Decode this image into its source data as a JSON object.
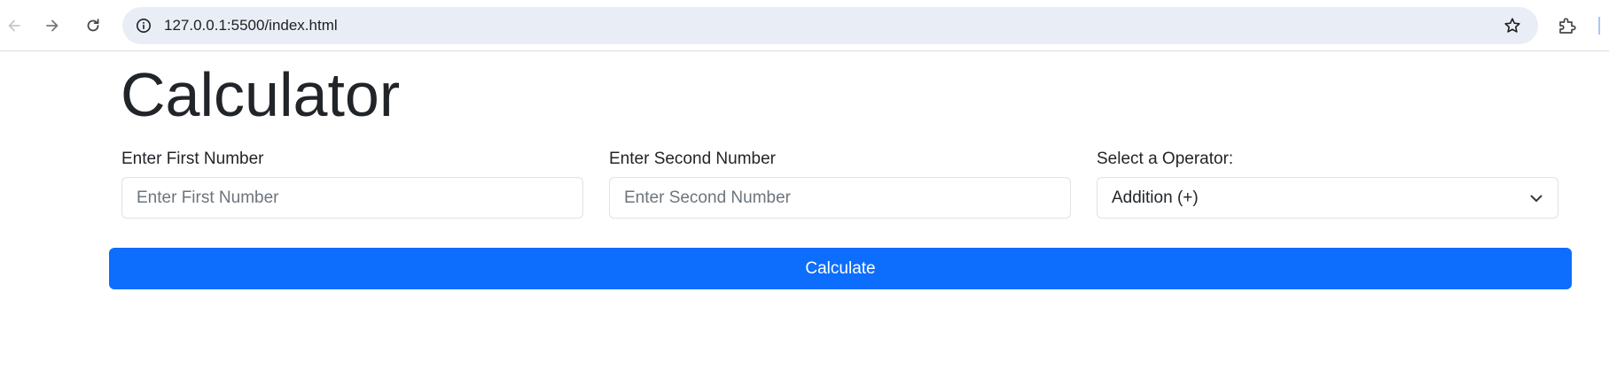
{
  "browser": {
    "url": "127.0.0.1:5500/index.html",
    "icons": {
      "back": "back-arrow-icon",
      "forward": "forward-arrow-icon",
      "reload": "reload-icon",
      "site_info": "site-info-icon",
      "bookmark": "star-icon",
      "extensions": "puzzle-icon"
    }
  },
  "page": {
    "title": "Calculator",
    "first_number": {
      "label": "Enter First Number",
      "placeholder": "Enter First Number",
      "value": ""
    },
    "second_number": {
      "label": "Enter Second Number",
      "placeholder": "Enter Second Number",
      "value": ""
    },
    "operator": {
      "label": "Select a Operator:",
      "selected": "Addition (+)"
    },
    "calculate_label": "Calculate"
  },
  "colors": {
    "primary": "#0d6efd",
    "text": "#212529",
    "placeholder": "#6c757d",
    "input_border": "#dee2e6",
    "omnibox_bg": "#e9eef6"
  }
}
